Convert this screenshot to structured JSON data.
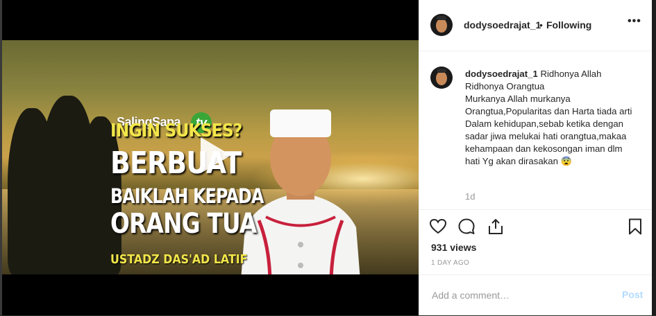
{
  "video": {
    "logo_text": "SalingSapa",
    "logo_badge": "tv",
    "overlay_line1": "INGIN SUKSES?",
    "overlay_line2": "BERBUAT",
    "overlay_line3": "BAIKLAH KEPADA",
    "overlay_line4": "ORANG TUA",
    "overlay_line5": "USTADZ DAS'AD LATIF"
  },
  "header": {
    "username": "dodysoedrajat_1",
    "separator": "•",
    "follow_status": "Following",
    "more_label": "•••"
  },
  "caption": {
    "username": "dodysoedrajat_1",
    "text": " Ridhonya Allah Ridhonya Orangtua\nMurkanya Allah murkanya Orangtua,Popularitas dan Harta tiada arti Dalam kehidupan,sebab ketika dengan sadar jiwa melukai hati orangtua,makaa kehampaan dan kekosongan iman dlm hati Yg akan dirasakan 😨",
    "age": "1d"
  },
  "stats": {
    "views": "931 views",
    "date": "1 DAY AGO"
  },
  "comment": {
    "placeholder": "Add a comment…",
    "post_label": "Post"
  },
  "icons": [
    "heart-icon",
    "comment-icon",
    "share-icon",
    "bookmark-icon",
    "play-icon",
    "more-icon"
  ],
  "colors": {
    "text": "#262626",
    "muted": "#999999",
    "post_disabled": "#b3dbff",
    "divider": "#efefef",
    "overlay_yellow": "#f2e64a"
  }
}
